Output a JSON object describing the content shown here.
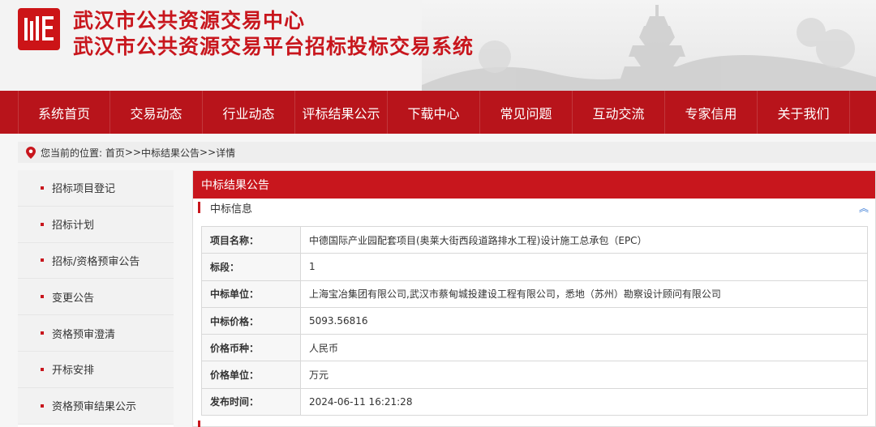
{
  "header": {
    "title_line1": "武汉市公共资源交易中心",
    "title_line2": "武汉市公共资源交易平台招标投标交易系统"
  },
  "nav": {
    "items": [
      {
        "label": "系统首页"
      },
      {
        "label": "交易动态"
      },
      {
        "label": "行业动态"
      },
      {
        "label": "评标结果公示"
      },
      {
        "label": "下载中心"
      },
      {
        "label": "常见问题"
      },
      {
        "label": "互动交流"
      },
      {
        "label": "专家信用"
      },
      {
        "label": "关于我们"
      }
    ]
  },
  "breadcrumb": {
    "prefix": "您当前的位置:",
    "home": "首页",
    "sep1": ">>",
    "section": "中标结果公告",
    "sep2": ">>",
    "current": "详情"
  },
  "sidebar": {
    "items": [
      {
        "label": "招标项目登记"
      },
      {
        "label": "招标计划"
      },
      {
        "label": "招标/资格预审公告"
      },
      {
        "label": "变更公告"
      },
      {
        "label": "资格预审澄清"
      },
      {
        "label": "开标安排"
      },
      {
        "label": "资格预审结果公示"
      }
    ]
  },
  "panel": {
    "title": "中标结果公告",
    "section_title": "中标信息",
    "collapse_icon": "double-chevron-up-icon",
    "rows": [
      {
        "key": "项目名称：",
        "value": "中德国际产业园配套项目(奥莱大街西段道路排水工程)设计施工总承包（EPC）"
      },
      {
        "key": "标段：",
        "value": "1"
      },
      {
        "key": "中标单位：",
        "value": "上海宝冶集团有限公司,武汉市蔡甸城投建设工程有限公司，悉地（苏州）勘察设计顾问有限公司"
      },
      {
        "key": "中标价格：",
        "value": "5093.56816"
      },
      {
        "key": "价格币种：",
        "value": "人民币"
      },
      {
        "key": "价格单位：",
        "value": "万元"
      },
      {
        "key": "发布时间：",
        "value": "2024-06-11 16:21:28"
      }
    ]
  },
  "colors": {
    "brand_red": "#c8161d",
    "nav_red": "#b8141b",
    "collapse_blue": "#3a7bd5"
  }
}
